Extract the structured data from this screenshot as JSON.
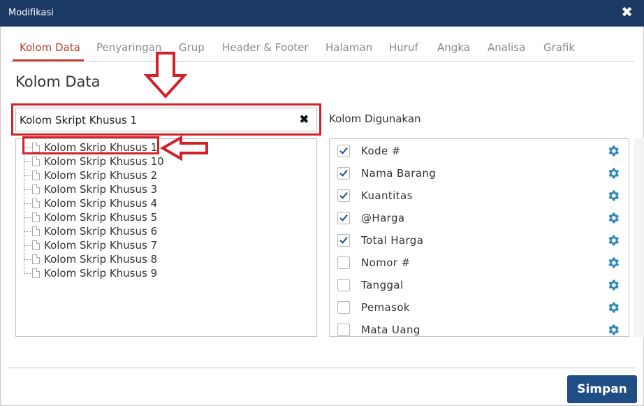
{
  "window": {
    "title": "Modifikasi",
    "close_glyph": "✖"
  },
  "tabs": [
    {
      "label": "Kolom Data",
      "active": true
    },
    {
      "label": "Penyaringan",
      "active": false
    },
    {
      "label": "Grup",
      "active": false
    },
    {
      "label": "Header & Footer",
      "active": false
    },
    {
      "label": "Halaman",
      "active": false
    },
    {
      "label": "Huruf",
      "active": false
    },
    {
      "label": "Angka",
      "active": false
    },
    {
      "label": "Analisa",
      "active": false
    },
    {
      "label": "Grafik",
      "active": false
    }
  ],
  "section_title": "Kolom Data",
  "search": {
    "value": "Kolom Skript Khusus 1",
    "clear_glyph": "✖"
  },
  "tree_items": [
    "Kolom Skrip Khusus 1",
    "Kolom Skrip Khusus 10",
    "Kolom Skrip Khusus 2",
    "Kolom Skrip Khusus 3",
    "Kolom Skrip Khusus 4",
    "Kolom Skrip Khusus 5",
    "Kolom Skrip Khusus 6",
    "Kolom Skrip Khusus 7",
    "Kolom Skrip Khusus 8",
    "Kolom Skrip Khusus 9"
  ],
  "used_columns": {
    "label": "Kolom Digunakan",
    "items": [
      {
        "label": "Kode #",
        "checked": true
      },
      {
        "label": "Nama Barang",
        "checked": true
      },
      {
        "label": "Kuantitas",
        "checked": true
      },
      {
        "label": "@Harga",
        "checked": true
      },
      {
        "label": "Total Harga",
        "checked": true
      },
      {
        "label": "Nomor #",
        "checked": false
      },
      {
        "label": "Tanggal",
        "checked": false
      },
      {
        "label": "Pemasok",
        "checked": false
      },
      {
        "label": "Mata Uang",
        "checked": false
      }
    ]
  },
  "footer": {
    "save_label": "Simpan"
  },
  "colors": {
    "titlebar": "#1b3a63",
    "accent": "#c0392b",
    "annotation": "#d32029",
    "primary_button": "#1f4e85",
    "gear": "#2e86b9"
  }
}
